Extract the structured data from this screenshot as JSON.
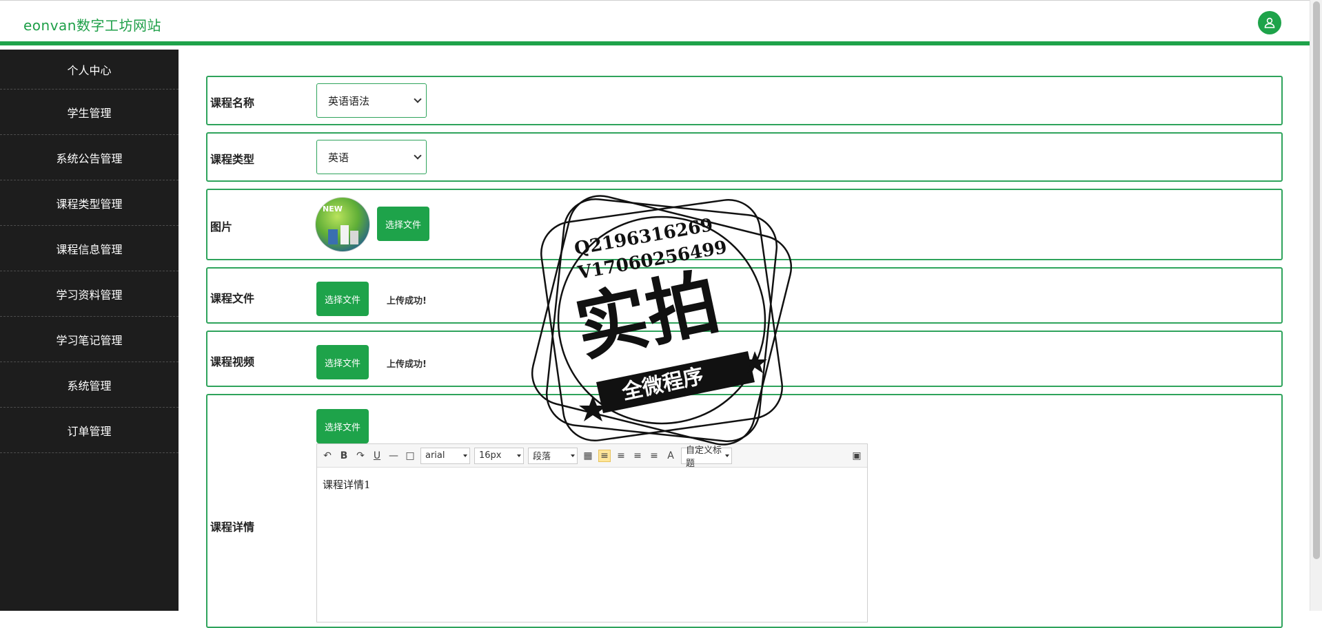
{
  "header": {
    "brand": "eonvan数字工坊网站"
  },
  "sidebar": {
    "items": [
      {
        "label": "个人中心"
      },
      {
        "label": "学生管理"
      },
      {
        "label": "系统公告管理"
      },
      {
        "label": "课程类型管理"
      },
      {
        "label": "课程信息管理"
      },
      {
        "label": "学习资料管理"
      },
      {
        "label": "学习笔记管理"
      },
      {
        "label": "系统管理"
      },
      {
        "label": "订单管理"
      }
    ]
  },
  "form": {
    "course_name": {
      "label": "课程名称",
      "value": "英语语法"
    },
    "course_type": {
      "label": "课程类型",
      "value": "英语"
    },
    "image": {
      "label": "图片",
      "button": "选择文件"
    },
    "course_file": {
      "label": "课程文件",
      "button": "选择文件",
      "status": "上传成功!"
    },
    "course_video": {
      "label": "课程视频",
      "button": "选择文件",
      "status": "上传成功!"
    },
    "course_detail": {
      "label": "课程详情",
      "button": "选择文件",
      "editor": {
        "font": "arial",
        "size": "16px",
        "paragraph": "段落",
        "custom_title": "自定义标题",
        "content": "课程详情1"
      }
    }
  },
  "watermark": {
    "line1": "Q2196316269",
    "line2": "V17060256499",
    "big": "实拍",
    "banner": "全微程序"
  },
  "colors": {
    "accent": "#1ea34a",
    "sidebar_bg": "#1d1d1d",
    "border": "#2ea35b"
  }
}
